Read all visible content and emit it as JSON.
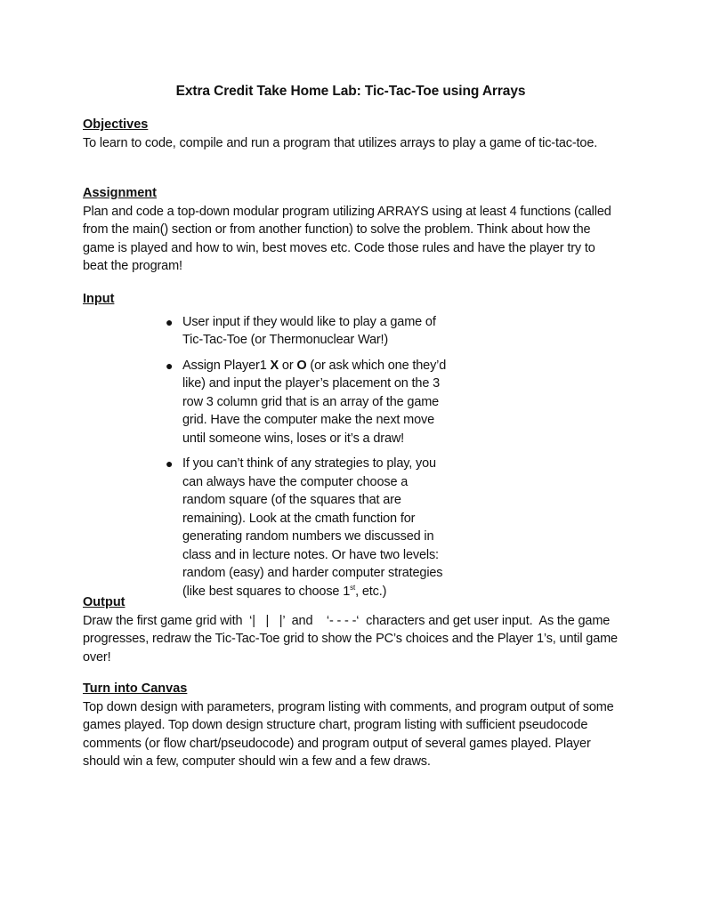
{
  "document": {
    "title": "Extra Credit Take Home Lab: Tic-Tac-Toe using Arrays",
    "objectives": {
      "heading": "Objectives",
      "text": "To learn to code, compile and run a program that utilizes arrays to play a game of tic-tac-toe."
    },
    "assignment": {
      "heading": "Assignment",
      "text": "Plan and code a top-down modular program utilizing ARRAYS using at least 4 functions (called from the main() section or from another function) to solve the problem.  Think about how the game is played and how to win, best moves etc.  Code those rules and have the player try to beat the program!"
    },
    "input": {
      "heading": "Input",
      "bullets": [
        {
          "text": "User input if they would like to play a game of Tic-Tac-Toe (or Thermonuclear War!)"
        },
        {
          "pre": "Assign Player1 ",
          "x": "X",
          "mid": " or ",
          "o": "O",
          "post": " (or ask which one they’d like) and input the player’s placement on the 3 row 3 column grid that is an array of the game grid.  Have the computer make the next move until someone wins, loses or it’s a draw!"
        },
        {
          "text": "If you can’t think of any strategies to play, you can always have the computer choose a random square (of the squares that are remaining).  Look at the cmath function for generating random numbers we discussed in class and in lecture notes. Or have two levels: random (easy) and harder computer strategies (like best squares to choose 1",
          "sup": "st",
          "tail": ", etc.)"
        }
      ]
    },
    "output": {
      "heading": "Output",
      "text": "Draw the first game grid with  ‘|   |   |’  and    ‘- - - -‘  characters and get user input.  As the game progresses, redraw the Tic-Tac-Toe grid to show the PC’s choices and the Player 1’s, until game over!"
    },
    "turn_in": {
      "heading": "Turn into Canvas",
      "text": "Top down design with parameters, program listing with comments, and program output of some games played. Top down design structure chart, program listing with sufficient pseudocode comments (or flow chart/pseudocode) and program output of several games played. Player should win a few, computer should win a few and a few draws."
    },
    "bullet_glyph": "●"
  }
}
